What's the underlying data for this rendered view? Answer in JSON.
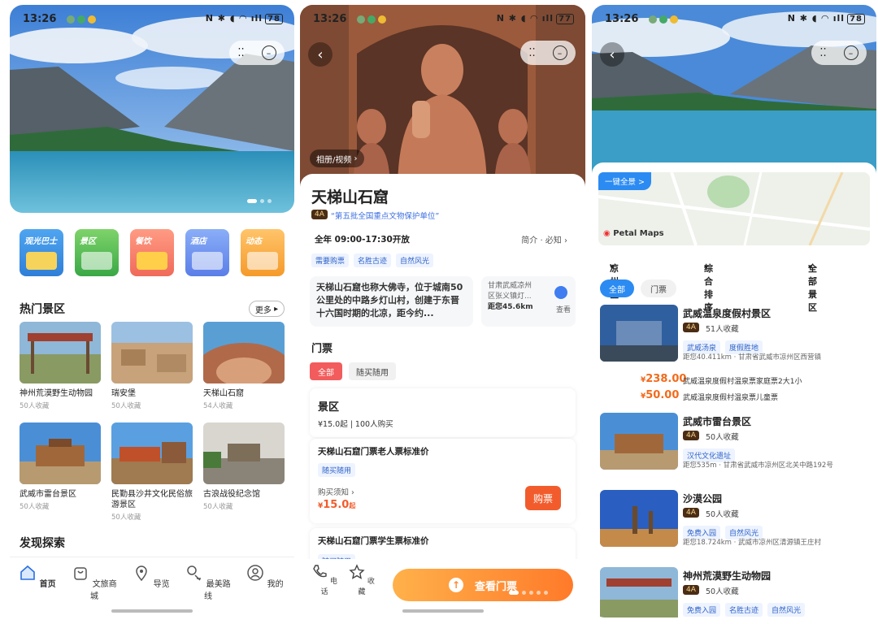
{
  "status": {
    "s1": {
      "time": "13:26",
      "battery": "78"
    },
    "s2": {
      "time": "13:26",
      "battery": "77"
    },
    "s3": {
      "time": "13:26",
      "battery": "78"
    }
  },
  "home": {
    "categories": [
      "观光巴士",
      "景区",
      "餐饮",
      "酒店",
      "动态"
    ],
    "hot_title": "热门景区",
    "more_label": "更多",
    "hot_spots": [
      {
        "name": "神州荒漠野生动物园",
        "count": "50人收藏"
      },
      {
        "name": "瑞安堡",
        "count": "50人收藏"
      },
      {
        "name": "天梯山石窟",
        "count": "54人收藏"
      },
      {
        "name": "武威市雷台景区",
        "count": "50人收藏"
      },
      {
        "name": "民勤县沙井文化民俗旅游景区",
        "count": "50人收藏"
      },
      {
        "name": "古浪战役纪念馆",
        "count": "50人收藏"
      }
    ],
    "discover_title": "发现探索",
    "tabs": [
      "首页",
      "文旅商城",
      "导览",
      "最美路线",
      "我的"
    ]
  },
  "detail": {
    "album_label": "相册/视频",
    "title": "天梯山石窟",
    "level": "4A",
    "honor": "“第五批全国重点文物保护单位”",
    "hours": "全年 09:00-17:30开放",
    "intro_link": "简介 · 必知",
    "tags": [
      "需要购票",
      "名胜古迹",
      "自然风光"
    ],
    "description": "天梯山石窟也称大佛寺，位于城南50公里处的中路乡灯山村，创建于东晋十六国时期的北凉，距今约...",
    "location_line1": "甘肃武威凉州",
    "location_line2": "区张义镇灯...",
    "distance": "距您45.6km",
    "view_label": "查看",
    "tickets_title": "门票",
    "filter_all": "全部",
    "filter_any": "随买随用",
    "scenic_title": "景区",
    "scenic_sub": "¥15.0起 | 100人购买",
    "ticket1_name": "天梯山石窟门票老人票标准价",
    "ticket1_tag": "随买随用",
    "notice_label": "购买须知",
    "ticket1_price": "15.0",
    "price_suffix": "起",
    "currency": "¥",
    "buy_label": "购票",
    "ticket2_name": "天梯山石窟门票学生票标准价",
    "ticket2_tag": "随买随用",
    "phone_label": "电话",
    "fav_label": "收藏",
    "cta_label": "查看门票"
  },
  "list": {
    "fullview_label": "一键全景 >",
    "map_brand": "Petal Maps",
    "filter_area": "凉州区",
    "filter_sort": "综合排序",
    "filter_scenic": "全部景区",
    "chip_all": "全部",
    "chip_ticket": "门票",
    "spots": [
      {
        "name": "武威温泉度假村景区",
        "level": "4A",
        "fav": "51人收藏",
        "tags": [
          "武威汤泉",
          "度假胜地"
        ],
        "dist": "距您40.411km · 甘肃省武威市凉州区西营镇"
      },
      {
        "name": "武威市雷台景区",
        "level": "4A",
        "fav": "50人收藏",
        "tags": [
          "汉代文化遗址"
        ],
        "dist": "距您535m · 甘肃省武威市凉州区北关中路192号"
      },
      {
        "name": "沙漠公园",
        "level": "4A",
        "fav": "50人收藏",
        "tags": [
          "免费入园",
          "自然风光"
        ],
        "dist": "距您18.724km · 武威市凉州区清源镇王庄村"
      },
      {
        "name": "神州荒漠野生动物园",
        "level": "4A",
        "fav": "50人收藏",
        "tags": [
          "免费入园",
          "名胜古迹",
          "自然风光"
        ],
        "dist": ""
      }
    ],
    "price1": "238.00",
    "price1_desc": "武威温泉度假村温泉票家庭票2大1小",
    "price2": "50.00",
    "price2_desc": "武威温泉度假村温泉票儿童票",
    "currency": "¥"
  },
  "colors": {
    "accent_blue": "#2b8bf2",
    "accent_orange": "#f36a1b",
    "buy_red": "#f25c2c",
    "level_brown": "#4b2c14"
  }
}
